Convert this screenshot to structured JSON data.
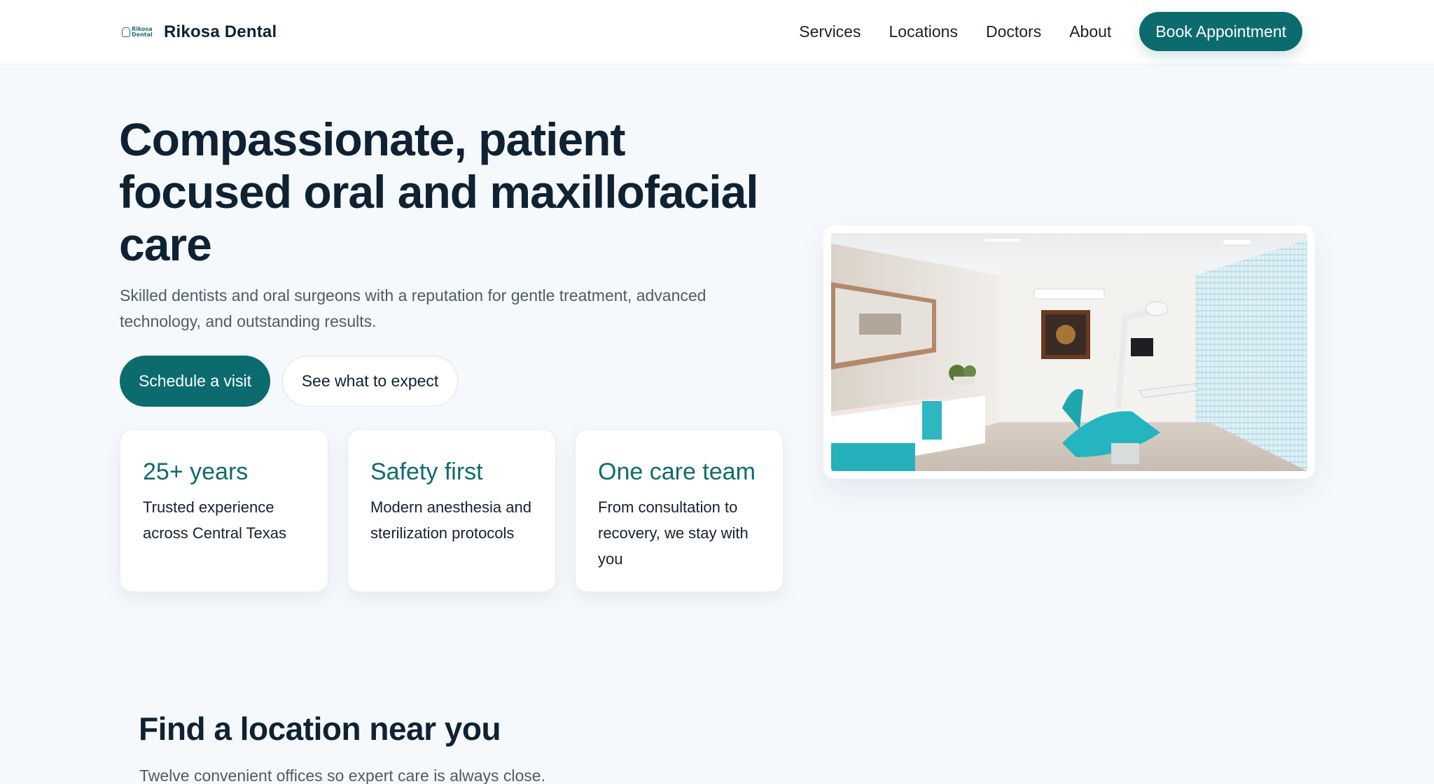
{
  "brand": {
    "logo_text": "Rikosa Dental",
    "name": "Rikosa Dental"
  },
  "nav": {
    "links": [
      "Services",
      "Locations",
      "Doctors",
      "About"
    ],
    "cta": "Book Appointment"
  },
  "hero": {
    "title": "Compassionate, patient focused oral and maxillofacial care",
    "subtitle": "Skilled dentists and oral surgeons with a reputation for gentle treatment, advanced technology, and outstanding results.",
    "primary_button": "Schedule a visit",
    "secondary_button": "See what to expect",
    "image_alt": "Modern dental operatory with teal patient chair"
  },
  "highlights": [
    {
      "title": "25+ years",
      "text": "Trusted experience across Central Texas"
    },
    {
      "title": "Safety first",
      "text": "Modern anesthesia and sterilization protocols"
    },
    {
      "title": "One care team",
      "text": "From consultation to recovery, we stay with you"
    }
  ],
  "locations": {
    "title": "Find a location near you",
    "subtitle": "Twelve convenient offices so expert care is always close."
  },
  "colors": {
    "accent": "#0c6b6e",
    "heading": "#0f2233",
    "background": "#f6f9fc"
  }
}
